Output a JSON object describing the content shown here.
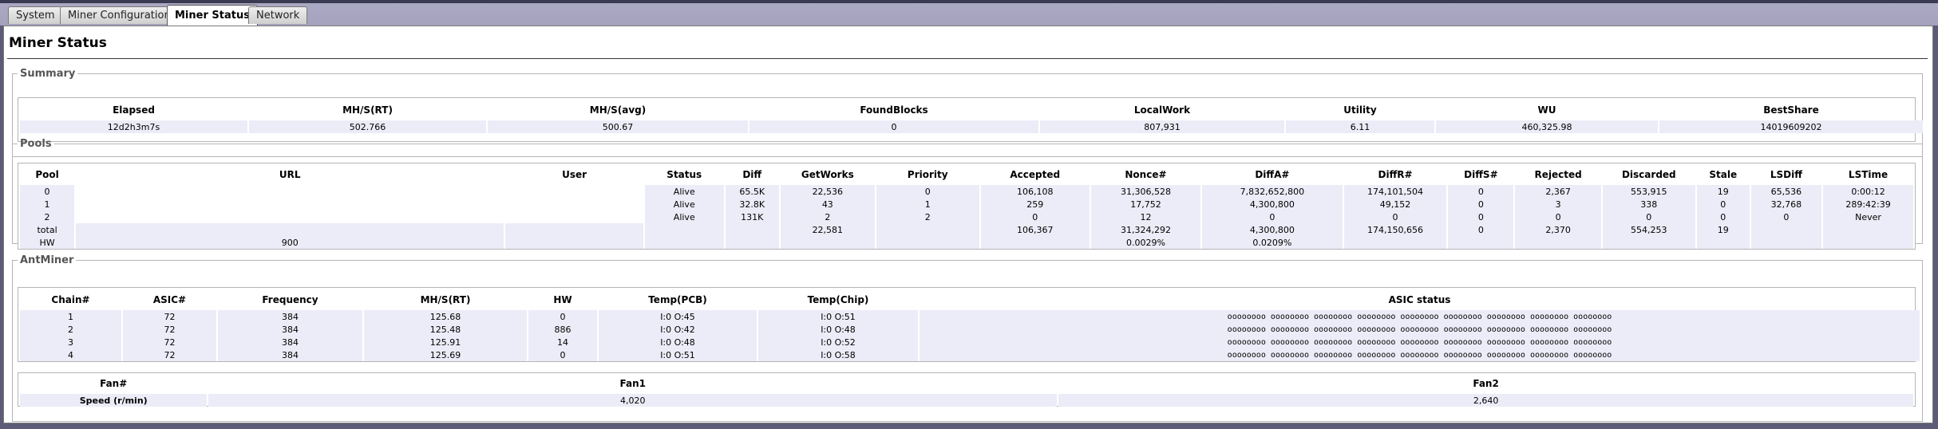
{
  "tabs": [
    {
      "label": "System",
      "active": false
    },
    {
      "label": "Miner Configuration",
      "active": false
    },
    {
      "label": "Miner Status",
      "active": true
    },
    {
      "label": "Network",
      "active": false
    }
  ],
  "page_title": "Miner Status",
  "summary": {
    "legend": "Summary",
    "headers": [
      "Elapsed",
      "MH/S(RT)",
      "MH/S(avg)",
      "FoundBlocks",
      "LocalWork",
      "Utility",
      "WU",
      "BestShare"
    ],
    "values": [
      "12d2h3m7s",
      "502.766",
      "500.67",
      "0",
      "807,931",
      "6.11",
      "460,325.98",
      "14019609202"
    ]
  },
  "pools": {
    "legend": "Pools",
    "headers": [
      "Pool",
      "URL",
      "User",
      "Status",
      "Diff",
      "GetWorks",
      "Priority",
      "Accepted",
      "Nonce#",
      "DiffA#",
      "DiffR#",
      "DiffS#",
      "Rejected",
      "Discarded",
      "Stale",
      "LSDiff",
      "LSTime"
    ],
    "rows": [
      [
        "0",
        "",
        "",
        "Alive",
        "65.5K",
        "22,536",
        "0",
        "106,108",
        "31,306,528",
        "7,832,652,800",
        "174,101,504",
        "0",
        "2,367",
        "553,915",
        "19",
        "65,536",
        "0:00:12"
      ],
      [
        "1",
        "",
        "",
        "Alive",
        "32.8K",
        "43",
        "1",
        "259",
        "17,752",
        "4,300,800",
        "49,152",
        "0",
        "3",
        "338",
        "0",
        "32,768",
        "289:42:39"
      ],
      [
        "2",
        "",
        "",
        "Alive",
        "131K",
        "2",
        "2",
        "0",
        "12",
        "0",
        "0",
        "0",
        "0",
        "0",
        "0",
        "0",
        "Never"
      ]
    ],
    "total_row": [
      "total",
      "",
      "",
      "",
      "",
      "22,581",
      "",
      "106,367",
      "31,324,292",
      "4,300,800",
      "174,150,656",
      "0",
      "2,370",
      "554,253",
      "19",
      "",
      ""
    ],
    "hw_row": [
      "HW",
      "900",
      "",
      "",
      "",
      "",
      "",
      "",
      "0.0029%",
      "0.0209%",
      "",
      "",
      "",
      "",
      "",
      "",
      ""
    ]
  },
  "antminer": {
    "legend": "AntMiner",
    "headers": [
      "Chain#",
      "ASIC#",
      "Frequency",
      "MH/S(RT)",
      "HW",
      "Temp(PCB)",
      "Temp(Chip)",
      "ASIC status"
    ],
    "rows": [
      [
        "1",
        "72",
        "384",
        "125.68",
        "0",
        "I:0 O:45",
        "I:0 O:51",
        "oooooooo oooooooo oooooooo oooooooo oooooooo oooooooo oooooooo oooooooo oooooooo"
      ],
      [
        "2",
        "72",
        "384",
        "125.48",
        "886",
        "I:0 O:42",
        "I:0 O:48",
        "oooooooo oooooooo oooooooo oooooooo oooooooo oooooooo oooooooo oooooooo oooooooo"
      ],
      [
        "3",
        "72",
        "384",
        "125.91",
        "14",
        "I:0 O:48",
        "I:0 O:52",
        "oooooooo oooooooo oooooooo oooooooo oooooooo oooooooo oooooooo oooooooo oooooooo"
      ],
      [
        "4",
        "72",
        "384",
        "125.69",
        "0",
        "I:0 O:51",
        "I:0 O:58",
        "oooooooo oooooooo oooooooo oooooooo oooooooo oooooooo oooooooo oooooooo oooooooo"
      ]
    ],
    "fan_headers": [
      "Fan#",
      "Fan1",
      "Fan2"
    ],
    "fan_row": [
      "Speed (r/min)",
      "4,020",
      "2,640"
    ]
  }
}
